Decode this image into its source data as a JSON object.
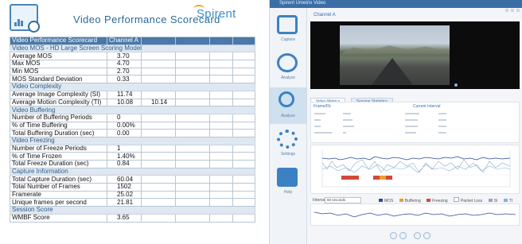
{
  "scorecard": {
    "title": "Video Performance Scorecard",
    "brand": "Spirent",
    "header_row": [
      "Video Performance Scorecard",
      "Channel A"
    ],
    "rows": [
      {
        "type": "section",
        "label": "Video MOS - HD Large Screen Scoring Model"
      },
      {
        "type": "data",
        "label": "Average MOS",
        "value": "3.70",
        "value2": ""
      },
      {
        "type": "data",
        "label": "Max MOS",
        "value": "4.70",
        "value2": ""
      },
      {
        "type": "data",
        "label": "Min MOS",
        "value": "2.70",
        "value2": ""
      },
      {
        "type": "data",
        "label": "MOS Standard Deviation",
        "value": "0.33",
        "value2": ""
      },
      {
        "type": "section",
        "label": "Video Complexity"
      },
      {
        "type": "data",
        "label": "Average Image Complexity (SI)",
        "value": "11.74",
        "value2": ""
      },
      {
        "type": "data",
        "label": "Average Motion Complexity (TI)",
        "value": "10.08",
        "value2": "10.14"
      },
      {
        "type": "section",
        "label": "Video Buffering"
      },
      {
        "type": "data",
        "label": "Number of Buffering Periods",
        "value": "0",
        "value2": ""
      },
      {
        "type": "data",
        "label": "% of Time Buffering",
        "value": "0.00%",
        "value2": ""
      },
      {
        "type": "data",
        "label": "Total Buffering Duration (sec)",
        "value": "0.00",
        "value2": ""
      },
      {
        "type": "section",
        "label": "Video Freezing"
      },
      {
        "type": "data",
        "label": "Number of Freeze Periods",
        "value": "1",
        "value2": ""
      },
      {
        "type": "data",
        "label": "% of Time Frozen",
        "value": "1.40%",
        "value2": ""
      },
      {
        "type": "data",
        "label": "Total Freeze Duration (sec)",
        "value": "0.84",
        "value2": ""
      },
      {
        "type": "section",
        "label": "Capture Information"
      },
      {
        "type": "data",
        "label": "Total Capture Duration (sec)",
        "value": "60.04",
        "value2": ""
      },
      {
        "type": "data",
        "label": "Total Number of Frames",
        "value": "1502",
        "value2": ""
      },
      {
        "type": "data",
        "label": "Framerate",
        "value": "25.02",
        "value2": ""
      },
      {
        "type": "data",
        "label": "Unique frames per second",
        "value": "21.81",
        "value2": ""
      },
      {
        "type": "section",
        "label": "Session Score"
      },
      {
        "type": "data",
        "label": "WMBF Score",
        "value": "3.65",
        "value2": ""
      }
    ]
  },
  "app": {
    "window_title": "Spirent Umetrix Video",
    "sidebar": [
      {
        "label": "Capture",
        "icon": "camera-icon"
      },
      {
        "label": "Analyze",
        "icon": "analyze-icon"
      },
      {
        "label": "Analyze",
        "icon": "magnifier-icon",
        "active": true
      },
      {
        "label": "Settings",
        "icon": "gear-icon"
      },
      {
        "label": "Help",
        "icon": "help-icon"
      }
    ],
    "channel_label": "Channel A",
    "tabs": [
      "Video Metrics",
      "Session Statistics"
    ],
    "stats_headers": [
      "Frame/Fb",
      "Current Interval"
    ],
    "interval_label": "Interval",
    "interval_value": "60 seconds",
    "legend": [
      "MOS",
      "Buffering",
      "Freezing",
      "Packet Loss",
      "SI",
      "TI"
    ],
    "colors": {
      "accent": "#3b82c4",
      "mos": "#2b4c9c",
      "buffering": "#e8a030",
      "freezing": "#d04a3a"
    }
  }
}
